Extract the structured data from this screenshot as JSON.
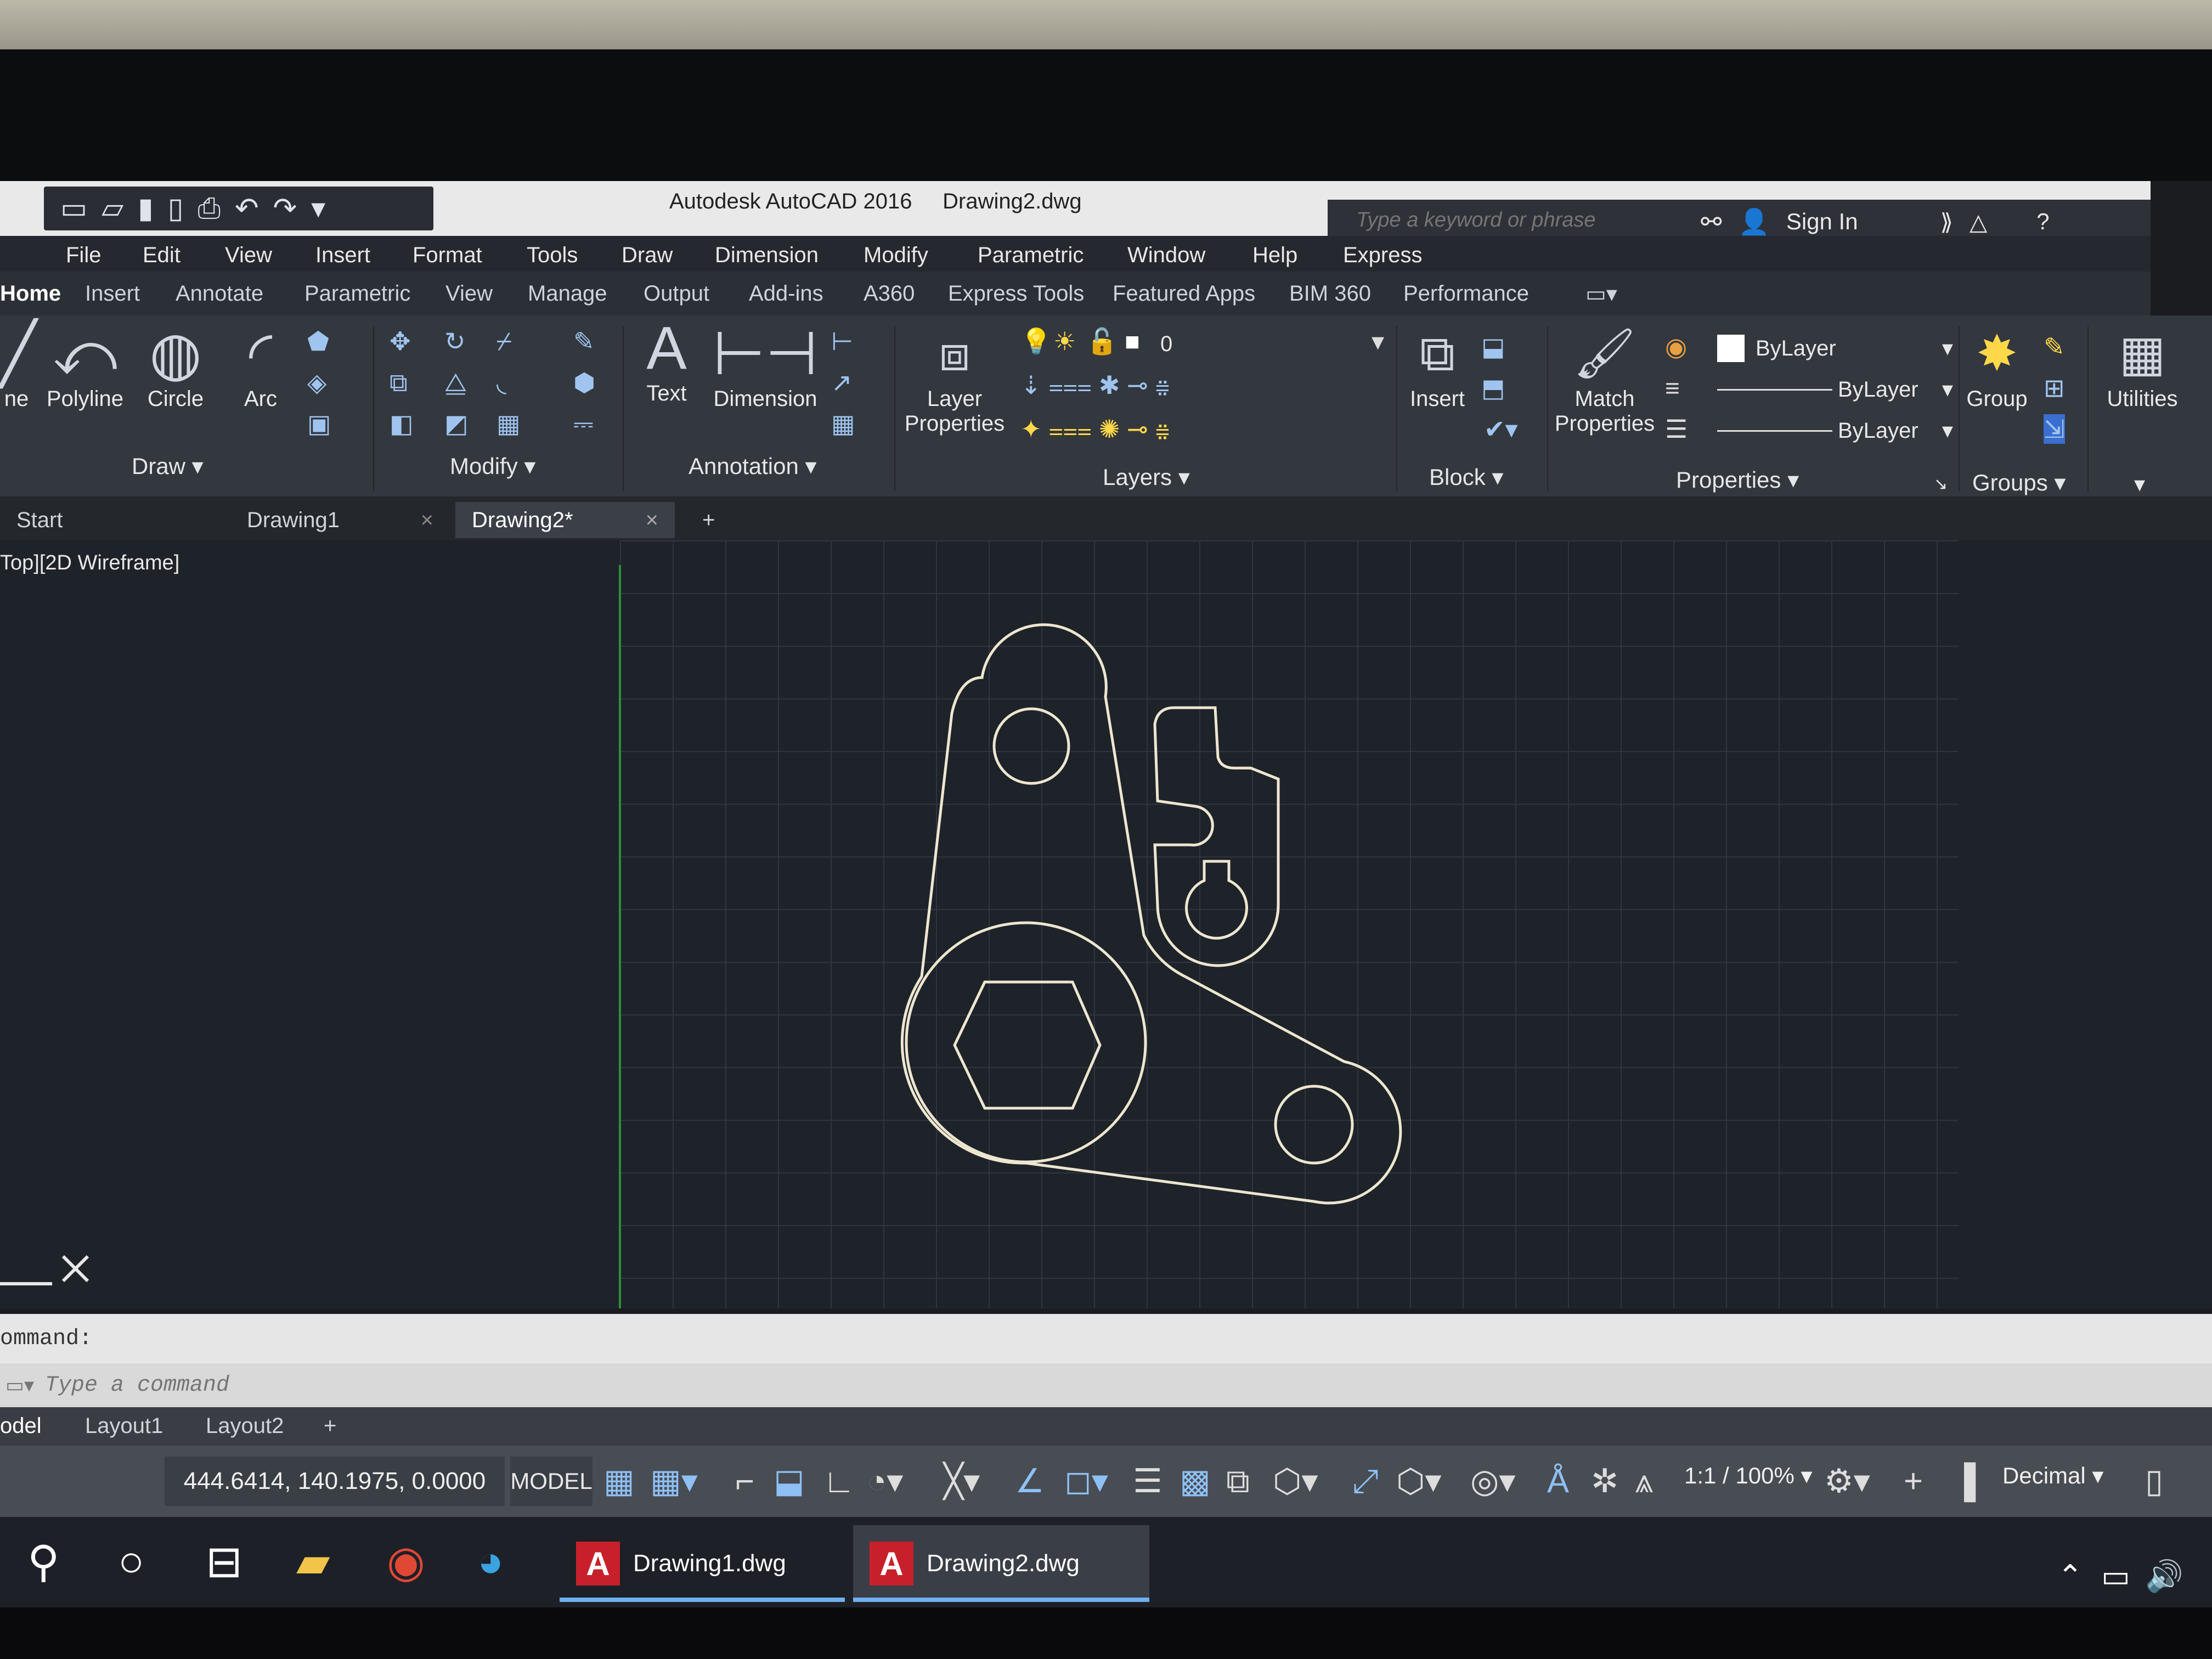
{
  "window": {
    "app_title": "Autodesk AutoCAD 2016",
    "file_title": "Drawing2.dwg"
  },
  "quick_access": {
    "icons": [
      "new-icon",
      "open-icon",
      "save-icon",
      "save-as-icon",
      "plot-icon",
      "undo-icon",
      "redo-icon",
      "customize-icon"
    ]
  },
  "search": {
    "placeholder": "Type a keyword or phrase"
  },
  "account": {
    "sign_in": "Sign In"
  },
  "menubar": [
    "File",
    "Edit",
    "View",
    "Insert",
    "Format",
    "Tools",
    "Draw",
    "Dimension",
    "Modify",
    "Parametric",
    "Window",
    "Help",
    "Express"
  ],
  "ribbon_tabs": [
    "Home",
    "Insert",
    "Annotate",
    "Parametric",
    "View",
    "Manage",
    "Output",
    "Add-ins",
    "A360",
    "Express Tools",
    "Featured Apps",
    "BIM 360",
    "Performance"
  ],
  "ribbon": {
    "draw": {
      "title": "Draw",
      "line_partial": "ne",
      "polyline": "Polyline",
      "circle": "Circle",
      "arc": "Arc"
    },
    "modify": {
      "title": "Modify"
    },
    "annotation": {
      "title": "Annotation",
      "text": "Text",
      "dimension": "Dimension"
    },
    "layers": {
      "title": "Layers",
      "layer_properties_1": "Layer",
      "layer_properties_2": "Properties",
      "current_layer": "0"
    },
    "block": {
      "title": "Block",
      "insert": "Insert"
    },
    "properties": {
      "title": "Properties",
      "match_1": "Match",
      "match_2": "Properties",
      "color": "ByLayer",
      "linetype": "ByLayer",
      "lineweight": "ByLayer"
    },
    "groups": {
      "title": "Groups",
      "group": "Group"
    },
    "utilities": {
      "label": "Utilities"
    }
  },
  "file_tabs": [
    {
      "label": "Start"
    },
    {
      "label": "Drawing1"
    },
    {
      "label": "Drawing2*"
    }
  ],
  "viewport": {
    "label": "Top][2D Wireframe]"
  },
  "command": {
    "history": "ommand:",
    "placeholder": "Type a command"
  },
  "layout_tabs": [
    "odel",
    "Layout1",
    "Layout2"
  ],
  "status": {
    "coords": "444.6414, 140.1975, 0.0000",
    "model": "MODEL",
    "scale": "1:1 / 100%",
    "units": "Decimal"
  },
  "taskbar": {
    "apps": [
      "Drawing1.dwg",
      "Drawing2.dwg"
    ]
  },
  "colors": {
    "accent": "#6fb0f0",
    "autocad_red": "#c8202a",
    "axis_green": "#2e8f3a"
  }
}
